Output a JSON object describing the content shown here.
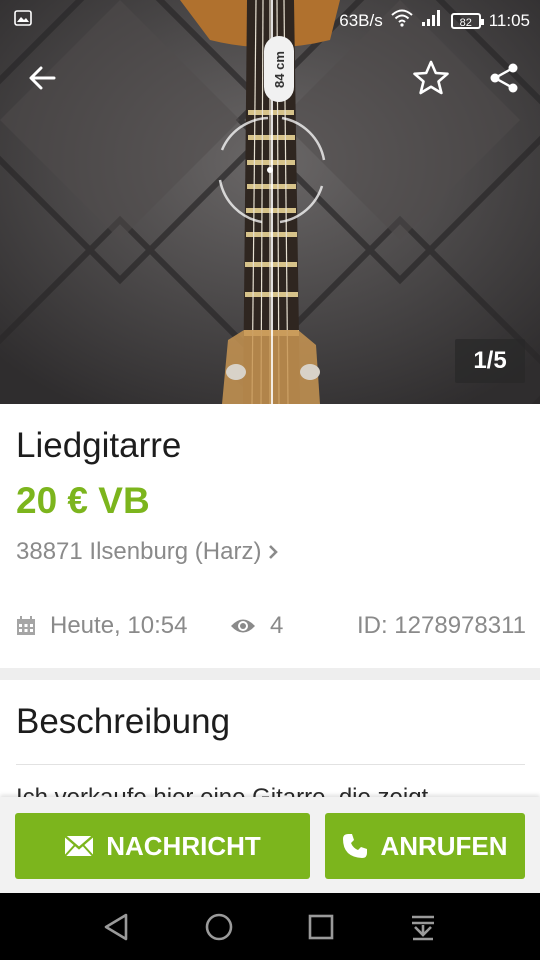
{
  "status_bar": {
    "net_speed": "63B/s",
    "battery": "82",
    "time": "11:05",
    "icons": [
      "image-notification-icon",
      "wifi-icon",
      "signal-icon",
      "battery-icon"
    ]
  },
  "photo": {
    "counter": "1/5",
    "ruler_label": "84 cm"
  },
  "listing": {
    "title": "Liedgitarre",
    "price": "20 € VB",
    "location": "38871 Ilsenburg (Harz)",
    "date": "Heute, 10:54",
    "views": "4",
    "ad_id": "ID: 1278978311"
  },
  "description": {
    "heading": "Beschreibung",
    "text": "Ich verkaufe hier eine Gitarre, die zeigt"
  },
  "actions": {
    "message_label": "NACHRICHT",
    "call_label": "ANRUFEN"
  },
  "colors": {
    "accent_green": "#7cb51d",
    "meta_gray": "#8a8a8a"
  }
}
